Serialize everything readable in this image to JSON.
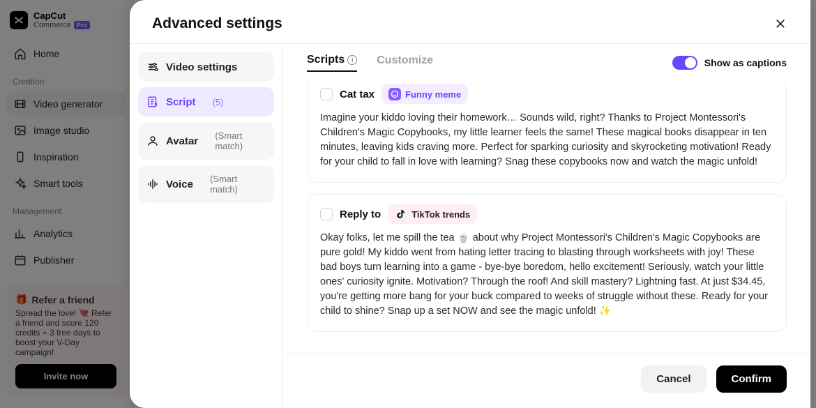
{
  "app": {
    "logo_top": "CapCut",
    "logo_sub": "Commerce",
    "logo_badge": "Pro"
  },
  "sidebar": {
    "home": "Home",
    "creation_label": "Creation",
    "creation": [
      {
        "label": "Video generator",
        "icon": "film"
      },
      {
        "label": "Image studio",
        "icon": "image"
      },
      {
        "label": "Inspiration",
        "icon": "phone"
      },
      {
        "label": "Smart tools",
        "icon": "sparkle"
      }
    ],
    "management_label": "Management",
    "management": [
      {
        "label": "Analytics",
        "icon": "chart"
      },
      {
        "label": "Publisher",
        "icon": "calendar"
      }
    ]
  },
  "refer": {
    "title": "Refer a friend",
    "gift": "🎁",
    "body": "Spread the love! 💘 Refer a friend and score 120 credits + 3 free days to boost your V-Day campaign!",
    "cta": "Invite now"
  },
  "modal": {
    "title": "Advanced settings",
    "nav": [
      {
        "label": "Video settings",
        "sub": ""
      },
      {
        "label": "Script",
        "sub": "(5)"
      },
      {
        "label": "Avatar",
        "sub": "(Smart match)"
      },
      {
        "label": "Voice",
        "sub": "(Smart match)"
      }
    ],
    "tabs": {
      "scripts": "Scripts",
      "customize": "Customize"
    },
    "toggle_label": "Show as captions",
    "scripts": [
      {
        "title": "Cat tax",
        "tag": "Funny meme",
        "tag_style": "purple",
        "body": "Imagine your kiddo loving their homework… Sounds wild, right? Thanks to Project Montessori's Children's Magic Copybooks, my little learner feels the same! These magical books disappear in ten minutes, leaving kids craving more. Perfect for sparking curiosity and skyrocketing motivation! Ready for your child to fall in love with learning? Snag these copybooks now and watch the magic unfold!"
      },
      {
        "title": "Reply to",
        "tag": "TikTok trends",
        "tag_style": "pink",
        "body": "Okay folks, let me spill the tea 🍵 about why Project Montessori's Children's Magic Copybooks are pure gold! My kiddo went from hating letter tracing to blasting through worksheets with joy! These bad boys turn learning into a game - bye-bye boredom, hello excitement! Seriously, watch your little ones' curiosity ignite. Motivation? Through the roof! And skill mastery? Lightning fast. At just $34.45, you're getting more bang for your buck compared to weeks of struggle without these. Ready for your child to shine? Snap up a set NOW and see the magic unfold! ✨"
      }
    ],
    "footer": {
      "cancel": "Cancel",
      "confirm": "Confirm"
    }
  }
}
